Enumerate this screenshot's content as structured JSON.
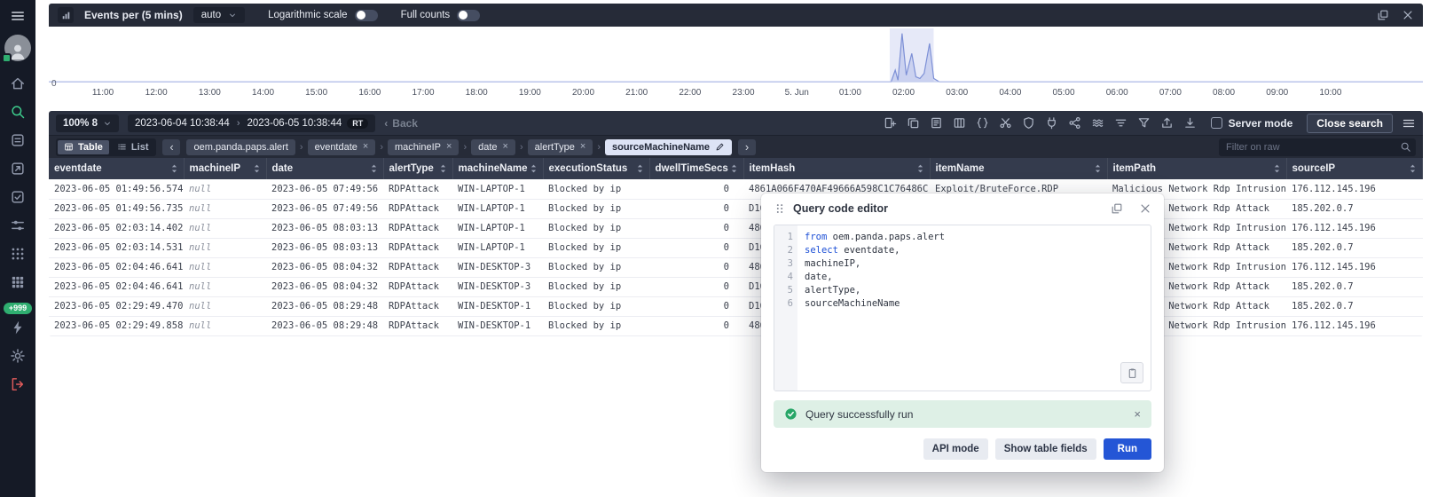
{
  "colors": {
    "accent_green": "#2fae70",
    "active_icon_green": "#3ecf8e",
    "run_blue": "#2456d6",
    "danger_red": "#e05b5b",
    "toast_green_bg": "#def0e6"
  },
  "sidebar": {
    "menu_icon": "hamburger-icon",
    "items": [
      {
        "id": "home",
        "icon": "home-icon"
      },
      {
        "id": "search",
        "icon": "search-icon",
        "active": true
      },
      {
        "id": "alerts",
        "icon": "alerts-icon"
      },
      {
        "id": "incidents",
        "icon": "incidents-icon"
      },
      {
        "id": "cases",
        "icon": "cases-icon"
      },
      {
        "id": "fields",
        "icon": "sliders-icon"
      },
      {
        "id": "apps",
        "icon": "apps-grid-icon"
      },
      {
        "id": "integrations",
        "icon": "apps-grid2-icon"
      },
      {
        "id": "notifications",
        "badge": "+999"
      },
      {
        "id": "automation",
        "icon": "bolt-icon"
      },
      {
        "id": "settings",
        "icon": "gear-icon"
      },
      {
        "id": "logout",
        "icon": "logout-icon",
        "danger": true
      }
    ]
  },
  "chart_panel": {
    "title": "Events per (5 mins)",
    "interval": "auto",
    "log_scale_label": "Logarithmic scale",
    "full_counts_label": "Full counts",
    "icons": [
      "popout-icon",
      "close-icon"
    ]
  },
  "toolbar": {
    "zoom_label": "100% 8",
    "date_from": "2023-06-04 10:38:44",
    "date_to": "2023-06-05 10:38:44",
    "rt_badge": "RT",
    "back_label": "Back",
    "icons": [
      "add-column-icon",
      "copy-rows-icon",
      "report-icon",
      "columns-icon",
      "code-braces-icon",
      "cut-icon",
      "shield-icon",
      "plugin-icon",
      "share-icon",
      "stream-icon",
      "filter-lines-icon",
      "funnel-icon",
      "export-icon",
      "download-icon"
    ],
    "server_mode_label": "Server mode",
    "server_mode_checked": false,
    "close_search_label": "Close search"
  },
  "filterbar": {
    "table_label": "Table",
    "list_label": "List",
    "source": "oem.panda.paps.alert",
    "chips": [
      "eventdate",
      "machineIP",
      "date",
      "alertType"
    ],
    "active_chip": "sourceMachineName",
    "filter_placeholder": "Filter on raw"
  },
  "table": {
    "columns": [
      "eventdate",
      "machineIP",
      "date",
      "alertType",
      "machineName",
      "executionStatus",
      "dwellTimeSecs",
      "itemHash",
      "itemName",
      "itemPath",
      "sourceIP"
    ],
    "rows": [
      [
        "2023-06-05 01:49:56.574",
        "null",
        "2023-06-05 07:49:56",
        "RDPAttack",
        "WIN-LAPTOP-1",
        "Blocked by ip",
        "0",
        "4861A066F470AF49666A598C1C76486C",
        "Exploit/BruteForce.RDP",
        "Malicious Network Rdp Intrusion",
        "176.112.145.196"
      ],
      [
        "2023-06-05 01:49:56.735",
        "null",
        "2023-06-05 07:49:56",
        "RDPAttack",
        "WIN-LAPTOP-1",
        "Blocked by ip",
        "0",
        "D16",
        "",
        "Malicious Network Rdp Attack",
        "185.202.0.7"
      ],
      [
        "2023-06-05 02:03:14.402",
        "null",
        "2023-06-05 08:03:13",
        "RDPAttack",
        "WIN-LAPTOP-1",
        "Blocked by ip",
        "0",
        "486",
        "",
        "Malicious Network Rdp Intrusion",
        "176.112.145.196"
      ],
      [
        "2023-06-05 02:03:14.531",
        "null",
        "2023-06-05 08:03:13",
        "RDPAttack",
        "WIN-LAPTOP-1",
        "Blocked by ip",
        "0",
        "D16",
        "",
        "Malicious Network Rdp Attack",
        "185.202.0.7"
      ],
      [
        "2023-06-05 02:04:46.641",
        "null",
        "2023-06-05 08:04:32",
        "RDPAttack",
        "WIN-DESKTOP-3",
        "Blocked by ip",
        "0",
        "486",
        "",
        "Malicious Network Rdp Intrusion",
        "176.112.145.196"
      ],
      [
        "2023-06-05 02:04:46.641",
        "null",
        "2023-06-05 08:04:32",
        "RDPAttack",
        "WIN-DESKTOP-3",
        "Blocked by ip",
        "0",
        "D16",
        "",
        "Malicious Network Rdp Attack",
        "185.202.0.7"
      ],
      [
        "2023-06-05 02:29:49.470",
        "null",
        "2023-06-05 08:29:48",
        "RDPAttack",
        "WIN-DESKTOP-1",
        "Blocked by ip",
        "0",
        "D16",
        "",
        "Malicious Network Rdp Attack",
        "185.202.0.7"
      ],
      [
        "2023-06-05 02:29:49.858",
        "null",
        "2023-06-05 08:29:48",
        "RDPAttack",
        "WIN-DESKTOP-1",
        "Blocked by ip",
        "0",
        "486",
        "",
        "Malicious Network Rdp Intrusion",
        "176.112.145.196"
      ]
    ]
  },
  "dialog": {
    "title": "Query code editor",
    "keywords": [
      "from",
      "select"
    ],
    "code_lines": [
      "from oem.panda.paps.alert",
      "select eventdate,",
      "machineIP,",
      "date,",
      "alertType,",
      "sourceMachineName"
    ],
    "toast": "Query successfully run",
    "api_mode_label": "API mode",
    "show_fields_label": "Show table fields",
    "run_label": "Run"
  },
  "chart_data": {
    "type": "line",
    "title": "Events per (5 mins)",
    "x_labels": [
      "11:00",
      "12:00",
      "13:00",
      "14:00",
      "15:00",
      "16:00",
      "17:00",
      "18:00",
      "19:00",
      "20:00",
      "21:00",
      "22:00",
      "23:00",
      "5. Jun",
      "01:00",
      "02:00",
      "03:00",
      "04:00",
      "05:00",
      "06:00",
      "07:00",
      "08:00",
      "09:00",
      "10:00"
    ],
    "baseline_label": "0",
    "ymax": 60,
    "grid": false,
    "selection": {
      "from": 0.612,
      "to": 0.644
    },
    "series": [
      {
        "name": "events",
        "points": [
          [
            0,
            0
          ],
          [
            0.6,
            0
          ],
          [
            0.613,
            0
          ],
          [
            0.616,
            14
          ],
          [
            0.618,
            2
          ],
          [
            0.621,
            58
          ],
          [
            0.624,
            8
          ],
          [
            0.628,
            34
          ],
          [
            0.631,
            6
          ],
          [
            0.634,
            4
          ],
          [
            0.637,
            10
          ],
          [
            0.641,
            46
          ],
          [
            0.644,
            4
          ],
          [
            0.648,
            0
          ],
          [
            1,
            0
          ]
        ]
      }
    ]
  }
}
